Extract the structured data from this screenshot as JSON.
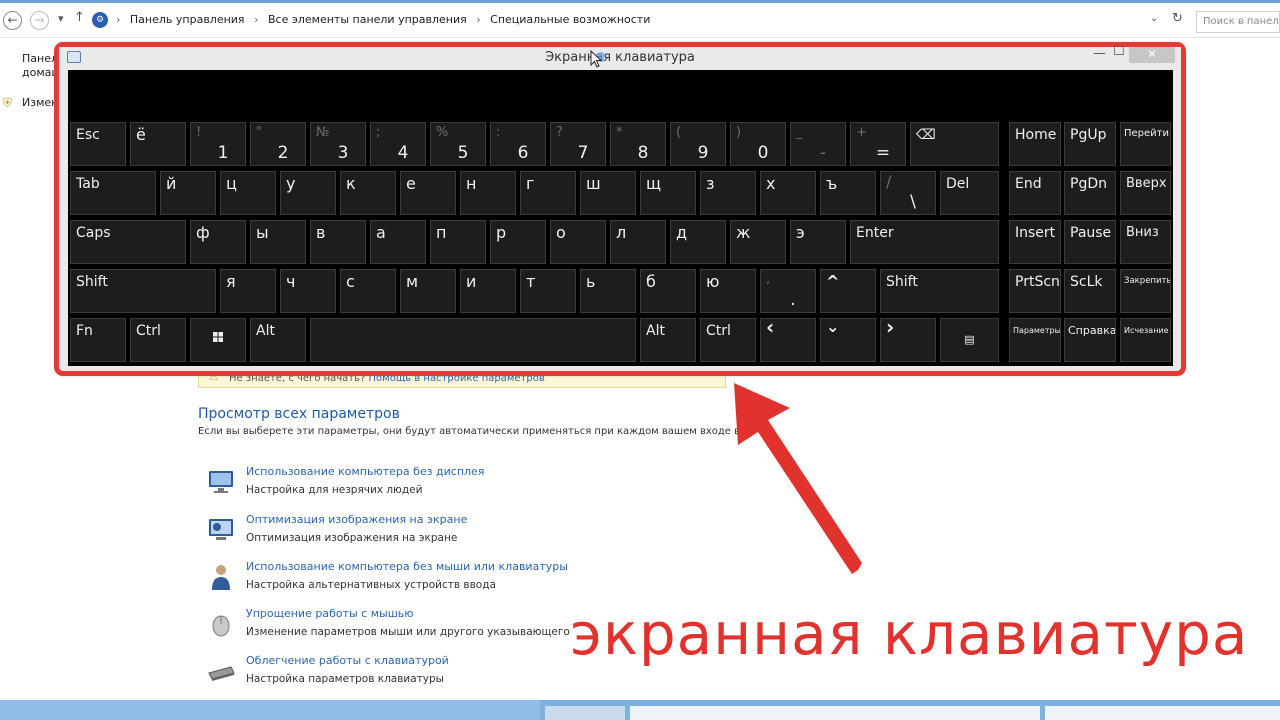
{
  "explorer": {
    "nav": {
      "back": "←",
      "forward": "→",
      "recent": "▾",
      "up": "↑"
    },
    "breadcrumbs": [
      "Панель управления",
      "Все элементы панели управления",
      "Специальные возможности"
    ],
    "search_placeholder": "Поиск в панели"
  },
  "left_pane": {
    "line1": "Панел",
    "line2": "домаш",
    "line3": "Измен"
  },
  "notice": {
    "prefix": "Не знаете, с чего начать?",
    "link": "Помощь в настройке параметров"
  },
  "content": {
    "title": "Просмотр всех параметров",
    "description": "Если вы выберете эти параметры, они будут автоматически применяться при каждом вашем входе в систему",
    "items": [
      {
        "title": "Использование компьютера без дисплея",
        "desc": "Настройка для незрячих людей",
        "icon": "monitor-icon"
      },
      {
        "title": "Оптимизация изображения на экране",
        "desc": "Оптимизация изображения на экране",
        "icon": "display-icon"
      },
      {
        "title": "Использование компьютера без мыши или клавиатуры",
        "desc": "Настройка альтернативных устройств ввода",
        "icon": "person-icon"
      },
      {
        "title": "Упрощение работы с мышью",
        "desc": "Изменение параметров мыши или другого указывающего",
        "icon": "mouse-icon"
      },
      {
        "title": "Облегчение работы с клавиатурой",
        "desc": "Настройка параметров клавиатуры",
        "icon": "keyboard-icon"
      }
    ]
  },
  "osk": {
    "title": "Экранная клавиатура",
    "minimize": "—",
    "maximize": "☐",
    "close": "✕",
    "keys": {
      "esc": "Esc",
      "yo": "ё",
      "n1": {
        "shift": "!",
        "main": "1"
      },
      "n2": {
        "shift": "\"",
        "main": "2"
      },
      "n3": {
        "shift": "№",
        "main": "3"
      },
      "n4": {
        "shift": ";",
        "main": "4"
      },
      "n5": {
        "shift": "%",
        "main": "5"
      },
      "n6": {
        "shift": ":",
        "main": "6"
      },
      "n7": {
        "shift": "?",
        "main": "7"
      },
      "n8": {
        "shift": "*",
        "main": "8"
      },
      "n9": {
        "shift": "(",
        "main": "9"
      },
      "n0": {
        "shift": ")",
        "main": "0"
      },
      "minus": {
        "shift": "_",
        "main": "-"
      },
      "equal": {
        "shift": "+",
        "main": "="
      },
      "backspace": "⌫",
      "home": "Home",
      "pgup": "PgUp",
      "goto": "Перейти",
      "tab": "Tab",
      "y": "й",
      "ts": "ц",
      "u": "у",
      "k": "к",
      "e": "е",
      "n": "н",
      "g": "г",
      "sh": "ш",
      "shch": "щ",
      "z": "з",
      "h": "х",
      "hard": "ъ",
      "slash": {
        "shift": "/",
        "main": "\\"
      },
      "del": "Del",
      "end": "End",
      "pgdn": "PgDn",
      "up_word": "Вверх",
      "caps": "Caps",
      "f": "ф",
      "yi": "ы",
      "v": "в",
      "a": "а",
      "p": "п",
      "r": "р",
      "o": "о",
      "l": "л",
      "d": "д",
      "zh": "ж",
      "ee": "э",
      "enter": "Enter",
      "insert": "Insert",
      "pause": "Pause",
      "down_word": "Вниз",
      "shift_l": "Shift",
      "ya": "я",
      "ch": "ч",
      "s": "с",
      "m": "м",
      "i": "и",
      "t": "т",
      "soft": "ь",
      "b": "б",
      "yu": "ю",
      "period": {
        "shift": ",",
        "main": "."
      },
      "up_arrow": "^",
      "shift_r": "Shift",
      "prtscn": "PrtScn",
      "sclk": "ScLk",
      "dock": "Закрепить",
      "fn": "Fn",
      "ctrl_l": "Ctrl",
      "alt_l": "Alt",
      "alt_r": "Alt",
      "ctrl_r": "Ctrl",
      "left": "‹",
      "down": "⌄",
      "right": "›",
      "menu": "▤",
      "options": "Параметры",
      "help": "Справка",
      "fade": "Исчезание"
    }
  },
  "caption": "экранная клавиатура",
  "colors": {
    "frame": "#e53a33",
    "key_bg": "#1d1d1e",
    "link": "#2b66b1",
    "caption": "#e2322d"
  }
}
